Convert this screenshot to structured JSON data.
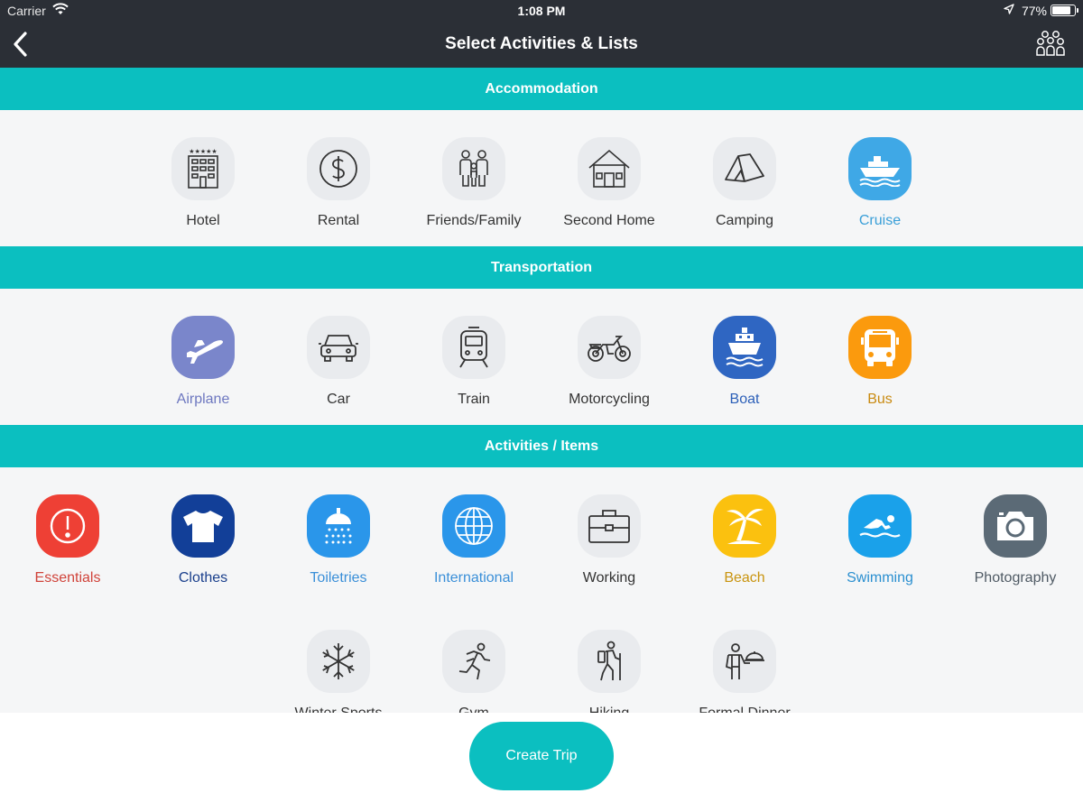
{
  "status_bar": {
    "carrier": "Carrier",
    "time": "1:08 PM",
    "battery": "77%"
  },
  "nav": {
    "title": "Select Activities & Lists"
  },
  "sections": {
    "accommodation": {
      "title": "Accommodation",
      "items": [
        {
          "label": "Hotel",
          "icon": "hotel-icon",
          "color": "#333333"
        },
        {
          "label": "Rental",
          "icon": "dollar-icon",
          "color": "#333333"
        },
        {
          "label": "Friends/Family",
          "icon": "family-icon",
          "color": "#333333"
        },
        {
          "label": "Second Home",
          "icon": "house-icon",
          "color": "#333333"
        },
        {
          "label": "Camping",
          "icon": "tent-icon",
          "color": "#333333"
        },
        {
          "label": "Cruise",
          "icon": "cruise-ship-icon",
          "color": "#3a9fd8",
          "selected": true
        }
      ]
    },
    "transportation": {
      "title": "Transportation",
      "items": [
        {
          "label": "Airplane",
          "icon": "airplane-icon",
          "color": "#6e78c0",
          "selected": true
        },
        {
          "label": "Car",
          "icon": "car-icon",
          "color": "#333333"
        },
        {
          "label": "Train",
          "icon": "train-icon",
          "color": "#333333"
        },
        {
          "label": "Motorcycling",
          "icon": "motorcycle-icon",
          "color": "#333333"
        },
        {
          "label": "Boat",
          "icon": "boat-icon",
          "color": "#2b5fb8",
          "selected": true
        },
        {
          "label": "Bus",
          "icon": "bus-icon",
          "color": "#c98a10",
          "selected": true
        }
      ]
    },
    "activities": {
      "title": "Activities / Items",
      "items": [
        {
          "label": "Essentials",
          "icon": "alert-icon",
          "color": "#d0433a",
          "selected": true
        },
        {
          "label": "Clothes",
          "icon": "shirt-icon",
          "color": "#1a3f8c",
          "selected": true
        },
        {
          "label": "Toiletries",
          "icon": "shower-icon",
          "color": "#3a8fd8",
          "selected": true
        },
        {
          "label": "International",
          "icon": "globe-icon",
          "color": "#3a8fd8",
          "selected": true
        },
        {
          "label": "Working",
          "icon": "briefcase-icon",
          "color": "#333333"
        },
        {
          "label": "Beach",
          "icon": "palm-tree-icon",
          "color": "#c9940f",
          "selected": true
        },
        {
          "label": "Swimming",
          "icon": "swimmer-icon",
          "color": "#2a8fd0",
          "selected": true
        },
        {
          "label": "Photography",
          "icon": "camera-icon",
          "color": "#4f5a64",
          "selected": true
        },
        {
          "label": "Winter Sports",
          "icon": "snowflake-icon",
          "color": "#333333"
        },
        {
          "label": "Gym",
          "icon": "runner-icon",
          "color": "#333333"
        },
        {
          "label": "Hiking",
          "icon": "hiker-icon",
          "color": "#333333"
        },
        {
          "label": "Formal Dinner",
          "icon": "waiter-icon",
          "color": "#333333"
        }
      ]
    }
  },
  "create_button": "Create Trip"
}
